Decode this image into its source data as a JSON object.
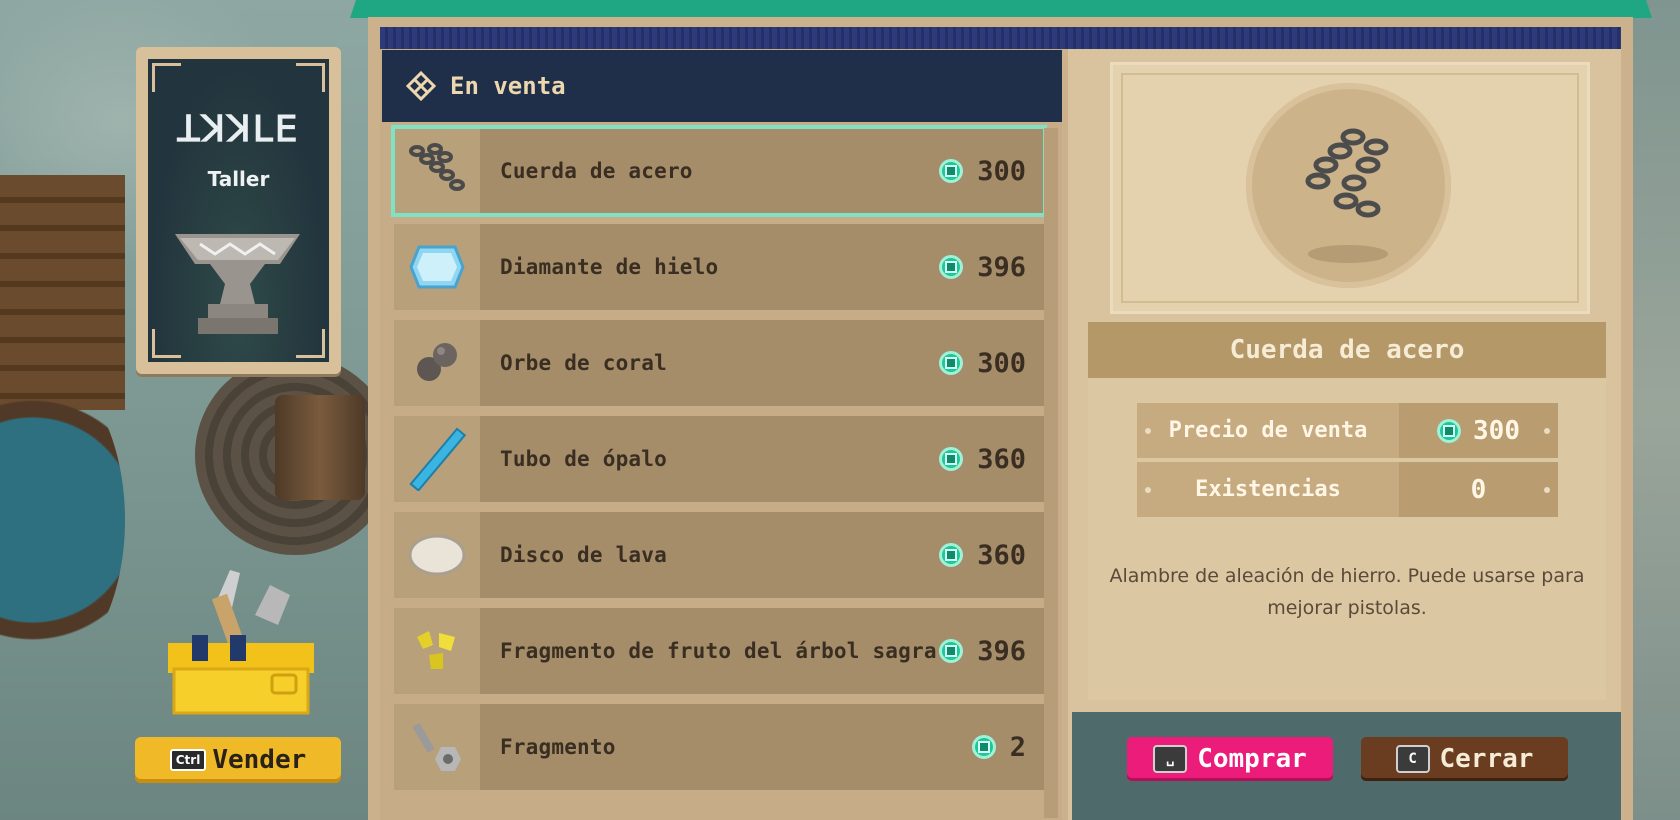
{
  "sign": {
    "glyphs": "ꓕꓘꓘꓡꓰ",
    "title": "Taller"
  },
  "vender": {
    "key": "Ctrl",
    "label": "Vender"
  },
  "header": {
    "title": "En venta"
  },
  "items": [
    {
      "name": "Cuerda de acero",
      "price": "300",
      "icon": "steel-chain-icon"
    },
    {
      "name": "Diamante de hielo",
      "price": "396",
      "icon": "ice-diamond-icon"
    },
    {
      "name": "Orbe de coral",
      "price": "300",
      "icon": "coral-orb-icon"
    },
    {
      "name": "Tubo de ópalo",
      "price": "360",
      "icon": "opal-tube-icon"
    },
    {
      "name": "Disco de lava",
      "price": "360",
      "icon": "lava-disc-icon"
    },
    {
      "name": "Fragmento de fruto del árbol sagra",
      "price": "396",
      "icon": "fruit-fragment-icon"
    },
    {
      "name": "Fragmento",
      "price": "2",
      "icon": "screw-nut-icon"
    }
  ],
  "selected_index": 0,
  "detail": {
    "title": "Cuerda de acero",
    "price_label": "Precio de venta",
    "price_value": "300",
    "stock_label": "Existencias",
    "stock_value": "0",
    "description": "Alambre de aleación de hierro. Puede usarse para mejorar pistolas."
  },
  "buttons": {
    "buy": {
      "key": "␣",
      "label": "Comprar"
    },
    "close": {
      "key": "C",
      "label": "Cerrar"
    }
  },
  "colors": {
    "accent": "#1dc79c",
    "buy": "#ec1c7a",
    "close": "#6a3d20",
    "header": "#1f2e49"
  }
}
